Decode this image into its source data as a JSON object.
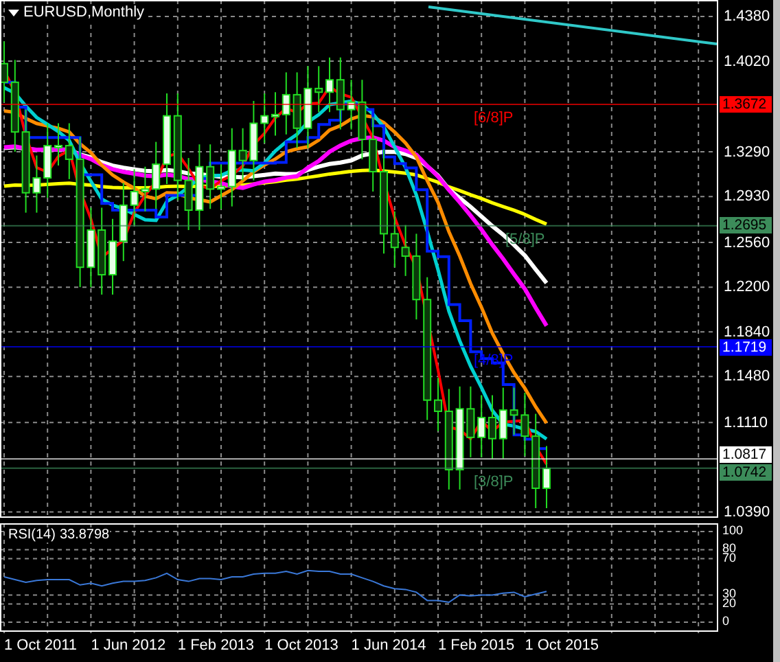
{
  "chart": {
    "title": "EURUSD,Monthly",
    "price_axis": [
      "1.4380",
      "1.4020",
      "1.3290",
      "1.2930",
      "1.2560",
      "1.2200",
      "1.1840",
      "1.1480",
      "1.1110",
      "1.0390"
    ],
    "price_tags": [
      {
        "label": "1.3672",
        "color": "#ff0000",
        "level": "[6/8]P"
      },
      {
        "label": "1.2695",
        "color": "#3c8c5a",
        "level": "[5/8]P"
      },
      {
        "label": "1.1719",
        "color": "#0000ff",
        "level": "[4/8]P"
      },
      {
        "label": "1.0817",
        "color": "#ffffff"
      },
      {
        "label": "1.0742",
        "color": "#3c8c5a",
        "level": "[3/8]P"
      }
    ],
    "time_axis": [
      "1 Oct 2011",
      "1 Jun 2012",
      "1 Feb 2013",
      "1 Oct 2013",
      "1 Jun 2014",
      "1 Feb 2015",
      "1 Oct 2015"
    ]
  },
  "rsi": {
    "value": "33.8798",
    "chart_data": {
      "type": "line",
      "grid": true,
      "ylim": [
        0,
        100
      ],
      "yticks": [
        {
          "value": 0,
          "label": "0"
        },
        {
          "value": 20,
          "label": "20"
        },
        {
          "value": 30,
          "label": "30"
        },
        {
          "value": 70,
          "label": "70"
        },
        {
          "value": 80,
          "label": "80"
        },
        {
          "value": 100,
          "label": "100"
        }
      ],
      "series": [
        {
          "name": "RSI(14)",
          "color": "#3a78d8",
          "values": [
            50,
            47,
            44,
            46,
            47,
            47,
            47,
            41,
            43,
            40,
            43,
            45,
            45,
            46,
            49,
            54,
            47,
            45,
            48,
            48,
            47,
            50,
            50,
            53,
            54,
            54,
            56,
            53,
            57,
            56,
            56,
            53,
            53,
            49,
            45,
            40,
            37,
            36,
            33,
            24,
            24,
            22,
            30,
            29,
            30,
            30,
            32,
            33,
            28,
            31,
            34
          ]
        }
      ]
    }
  }
}
